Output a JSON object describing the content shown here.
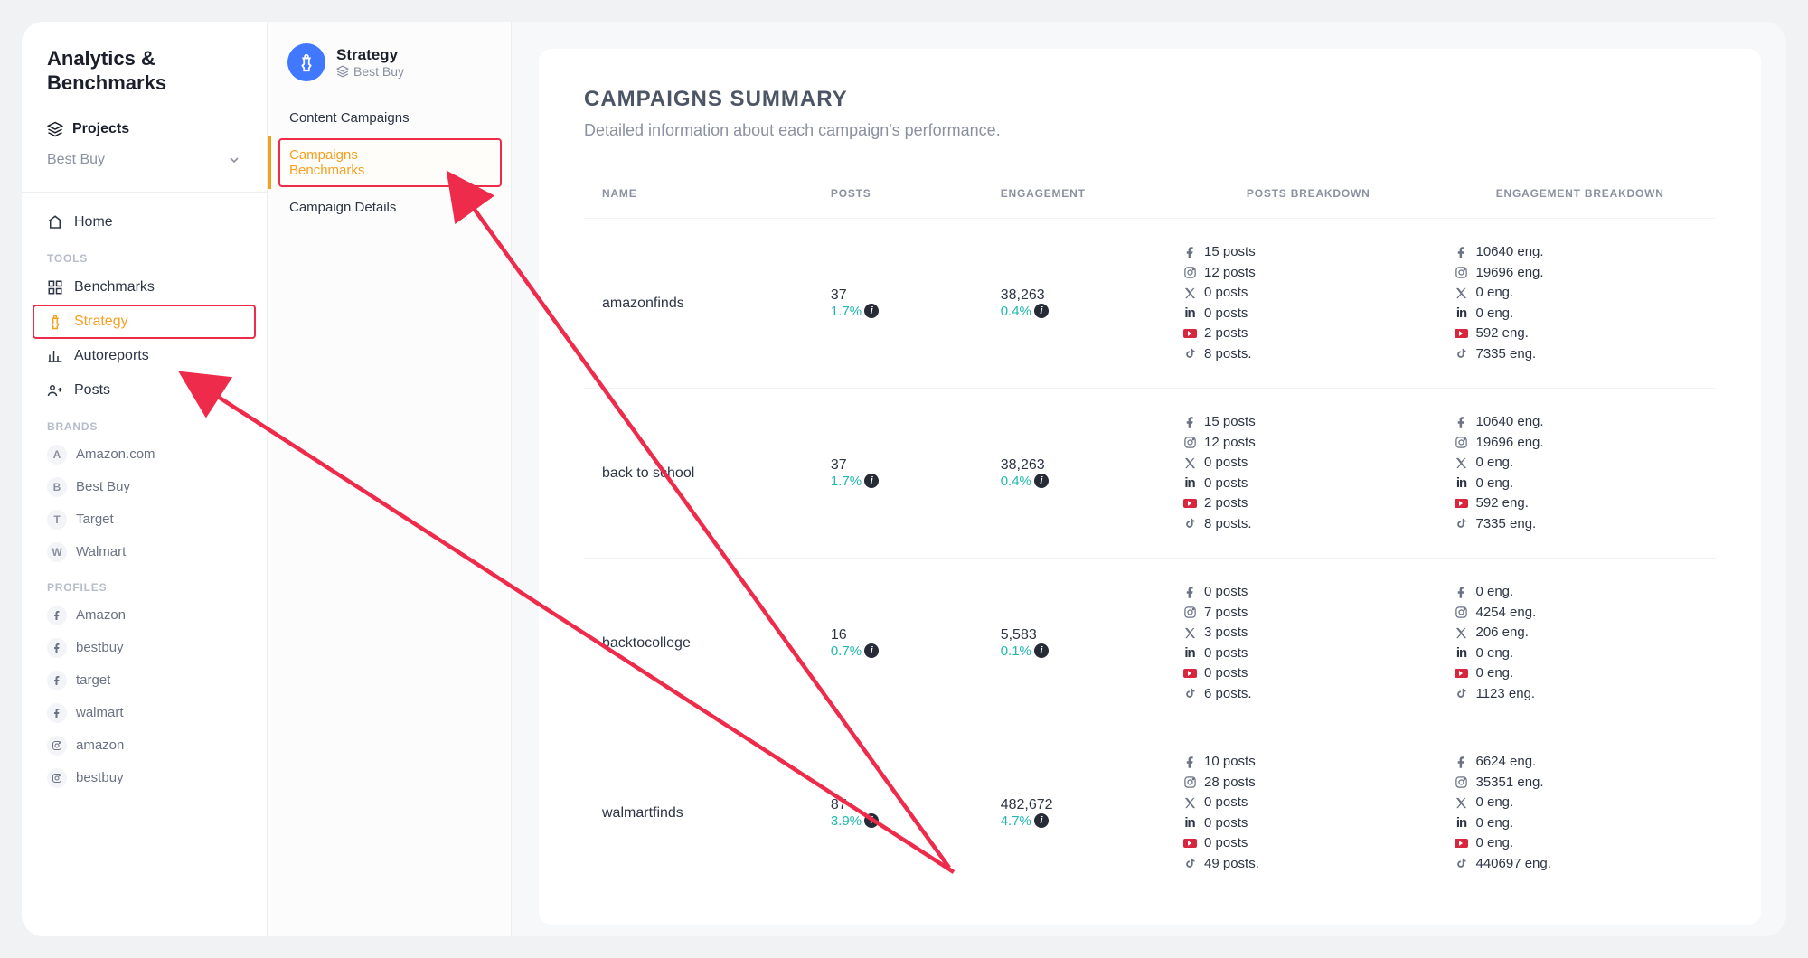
{
  "sidebar": {
    "title": "Analytics & Benchmarks",
    "projects_label": "Projects",
    "project_selected": "Best Buy",
    "home_label": "Home",
    "tools_label": "TOOLS",
    "tools": {
      "benchmarks": "Benchmarks",
      "strategy": "Strategy",
      "autoreports": "Autoreports",
      "posts": "Posts"
    },
    "brands_label": "BRANDS",
    "brands": [
      {
        "letter": "A",
        "name": "Amazon.com"
      },
      {
        "letter": "B",
        "name": "Best Buy"
      },
      {
        "letter": "T",
        "name": "Target"
      },
      {
        "letter": "W",
        "name": "Walmart"
      }
    ],
    "profiles_label": "PROFILES",
    "profiles": [
      {
        "platform": "facebook",
        "name": "Amazon"
      },
      {
        "platform": "facebook",
        "name": "bestbuy"
      },
      {
        "platform": "facebook",
        "name": "target"
      },
      {
        "platform": "facebook",
        "name": "walmart"
      },
      {
        "platform": "instagram",
        "name": "amazon"
      },
      {
        "platform": "instagram",
        "name": "bestbuy"
      }
    ]
  },
  "subsidebar": {
    "title": "Strategy",
    "subtitle": "Best Buy",
    "items": [
      {
        "label": "Content Campaigns",
        "active": false
      },
      {
        "label": "Campaigns Benchmarks",
        "active": true
      },
      {
        "label": "Campaign Details",
        "active": false
      }
    ]
  },
  "main": {
    "title": "CAMPAIGNS SUMMARY",
    "subtitle": "Detailed information about each campaign's performance.",
    "columns": {
      "name": "NAME",
      "posts": "POSTS",
      "engagement": "ENGAGEMENT",
      "posts_breakdown": "POSTS BREAKDOWN",
      "engagement_breakdown": "ENGAGEMENT BREAKDOWN"
    },
    "rows": [
      {
        "name": "amazonfinds",
        "posts": "37",
        "posts_pct": "1.7%",
        "engagement": "38,263",
        "engagement_pct": "0.4%",
        "pb": [
          {
            "p": "facebook",
            "t": "15 posts"
          },
          {
            "p": "instagram",
            "t": "12 posts"
          },
          {
            "p": "x",
            "t": "0 posts"
          },
          {
            "p": "linkedin",
            "t": "0 posts"
          },
          {
            "p": "youtube",
            "t": "2 posts"
          },
          {
            "p": "tiktok",
            "t": "8 posts."
          }
        ],
        "eb": [
          {
            "p": "facebook",
            "t": "10640 eng."
          },
          {
            "p": "instagram",
            "t": "19696 eng."
          },
          {
            "p": "x",
            "t": "0 eng."
          },
          {
            "p": "linkedin",
            "t": "0 eng."
          },
          {
            "p": "youtube",
            "t": "592 eng."
          },
          {
            "p": "tiktok",
            "t": "7335 eng."
          }
        ]
      },
      {
        "name": "back to school",
        "posts": "37",
        "posts_pct": "1.7%",
        "engagement": "38,263",
        "engagement_pct": "0.4%",
        "pb": [
          {
            "p": "facebook",
            "t": "15 posts"
          },
          {
            "p": "instagram",
            "t": "12 posts"
          },
          {
            "p": "x",
            "t": "0 posts"
          },
          {
            "p": "linkedin",
            "t": "0 posts"
          },
          {
            "p": "youtube",
            "t": "2 posts"
          },
          {
            "p": "tiktok",
            "t": "8 posts."
          }
        ],
        "eb": [
          {
            "p": "facebook",
            "t": "10640 eng."
          },
          {
            "p": "instagram",
            "t": "19696 eng."
          },
          {
            "p": "x",
            "t": "0 eng."
          },
          {
            "p": "linkedin",
            "t": "0 eng."
          },
          {
            "p": "youtube",
            "t": "592 eng."
          },
          {
            "p": "tiktok",
            "t": "7335 eng."
          }
        ]
      },
      {
        "name": "backtocollege",
        "posts": "16",
        "posts_pct": "0.7%",
        "engagement": "5,583",
        "engagement_pct": "0.1%",
        "pb": [
          {
            "p": "facebook",
            "t": "0 posts"
          },
          {
            "p": "instagram",
            "t": "7 posts"
          },
          {
            "p": "x",
            "t": "3 posts"
          },
          {
            "p": "linkedin",
            "t": "0 posts"
          },
          {
            "p": "youtube",
            "t": "0 posts"
          },
          {
            "p": "tiktok",
            "t": "6 posts."
          }
        ],
        "eb": [
          {
            "p": "facebook",
            "t": "0 eng."
          },
          {
            "p": "instagram",
            "t": "4254 eng."
          },
          {
            "p": "x",
            "t": "206 eng."
          },
          {
            "p": "linkedin",
            "t": "0 eng."
          },
          {
            "p": "youtube",
            "t": "0 eng."
          },
          {
            "p": "tiktok",
            "t": "1123 eng."
          }
        ]
      },
      {
        "name": "walmartfinds",
        "posts": "87",
        "posts_pct": "3.9%",
        "engagement": "482,672",
        "engagement_pct": "4.7%",
        "pb": [
          {
            "p": "facebook",
            "t": "10 posts"
          },
          {
            "p": "instagram",
            "t": "28 posts"
          },
          {
            "p": "x",
            "t": "0 posts"
          },
          {
            "p": "linkedin",
            "t": "0 posts"
          },
          {
            "p": "youtube",
            "t": "0 posts"
          },
          {
            "p": "tiktok",
            "t": "49 posts."
          }
        ],
        "eb": [
          {
            "p": "facebook",
            "t": "6624 eng."
          },
          {
            "p": "instagram",
            "t": "35351 eng."
          },
          {
            "p": "x",
            "t": "0 eng."
          },
          {
            "p": "linkedin",
            "t": "0 eng."
          },
          {
            "p": "youtube",
            "t": "0 eng."
          },
          {
            "p": "tiktok",
            "t": "440697 eng."
          }
        ]
      }
    ]
  }
}
